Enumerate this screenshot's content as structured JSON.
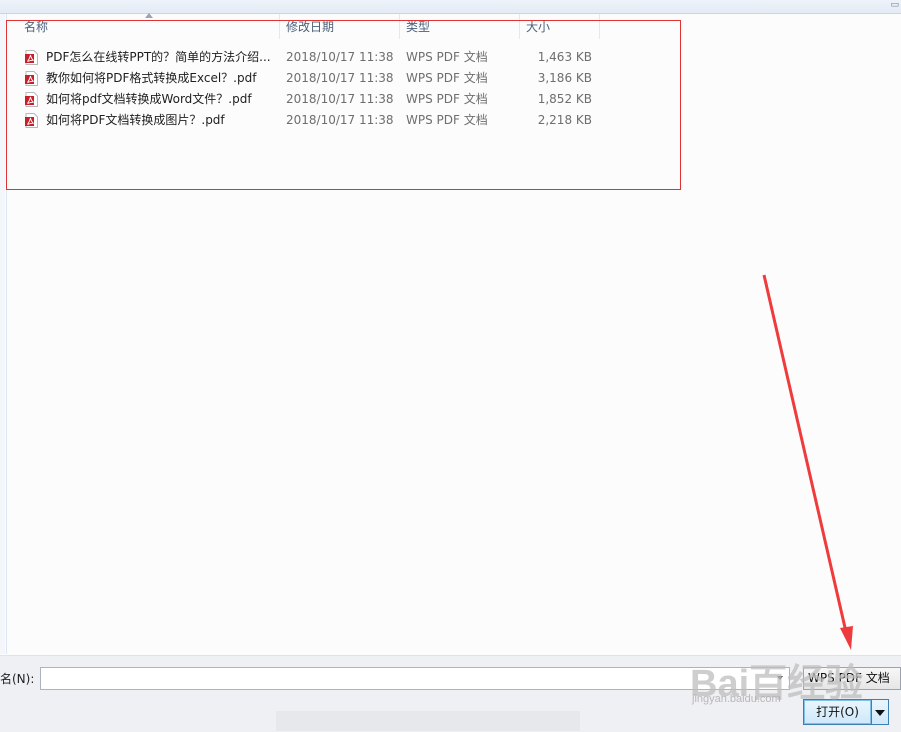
{
  "header": {
    "columns": [
      "名称",
      "修改日期",
      "类型",
      "大小"
    ]
  },
  "files": [
    {
      "name": "PDF怎么在线转PPT的？简单的方法介绍...",
      "date": "2018/10/17 11:38",
      "type": "WPS PDF 文档",
      "size": "1,463 KB"
    },
    {
      "name": "教你如何将PDF格式转换成Excel？.pdf",
      "date": "2018/10/17 11:38",
      "type": "WPS PDF 文档",
      "size": "3,186 KB"
    },
    {
      "name": "如何将pdf文档转换成Word文件？.pdf",
      "date": "2018/10/17 11:38",
      "type": "WPS PDF 文档",
      "size": "1,852 KB"
    },
    {
      "name": "如何将PDF文档转换成图片？.pdf",
      "date": "2018/10/17 11:38",
      "type": "WPS PDF 文档",
      "size": "2,218 KB"
    }
  ],
  "footer": {
    "filename_label": "名(N):",
    "filename_value": "",
    "filetype_value": "WPS PDF 文档",
    "open_label": "打开(O)"
  },
  "watermark": {
    "text": "Bai百经验",
    "url": "jingyan.baidu.com"
  },
  "colors": {
    "annotation_red": "#e03434",
    "pdf_icon_red": "#c8202a"
  },
  "icons": [
    "pdf-file-icon",
    "sort-ascending-icon",
    "dropdown-arrow-icon"
  ]
}
